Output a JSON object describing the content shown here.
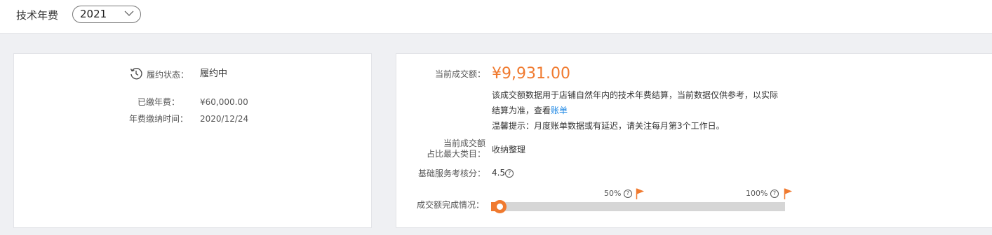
{
  "header": {
    "title": "技术年费",
    "year_select": {
      "value": "2021"
    }
  },
  "left_panel": {
    "status_label": "履约状态：",
    "status_value": "履约中",
    "paid_label": "已缴年费：",
    "paid_value": "¥60,000.00",
    "time_label": "年费缴纳时间：",
    "time_value": "2020/12/24"
  },
  "right_panel": {
    "amount_label": "当前成交额：",
    "amount_value": "¥9,931.00",
    "desc_line1": "该成交额数据用于店铺自然年内的技术年费结算，当前数据仅供参考，以实际",
    "desc_line2_prefix": "结算为准，查看",
    "desc_link": "账单",
    "desc_line3": "温馨提示：月度账单数据或有延迟，请关注每月第3个工作日。",
    "category_label_line1": "当前成交额",
    "category_label_line2": "占比最大类目：",
    "category_value": "收纳整理",
    "score_label": "基础服务考核分：",
    "score_value": "4.5",
    "progress_label": "成交额完成情况：",
    "progress_fraction": 0,
    "milestones": [
      {
        "label": "50%"
      },
      {
        "label": "100%"
      }
    ],
    "accent_color": "#f07a2f",
    "link_color": "#1e88e5"
  }
}
